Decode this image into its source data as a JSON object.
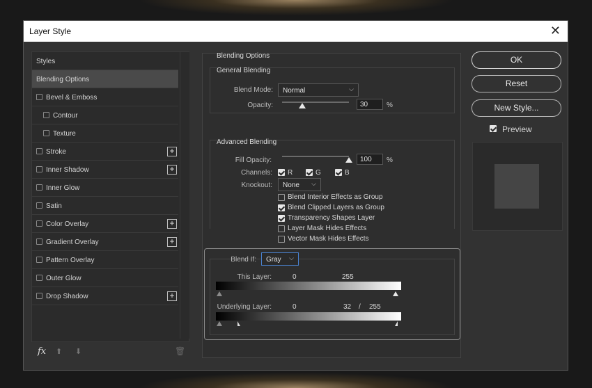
{
  "dialog": {
    "title": "Layer Style"
  },
  "styles_list": {
    "items": [
      {
        "label": "Styles",
        "checkbox": false,
        "plus": false,
        "indent": false,
        "selected": false
      },
      {
        "label": "Blending Options",
        "checkbox": false,
        "plus": false,
        "indent": false,
        "selected": true
      },
      {
        "label": "Bevel & Emboss",
        "checkbox": true,
        "plus": false,
        "indent": false,
        "selected": false
      },
      {
        "label": "Contour",
        "checkbox": true,
        "plus": false,
        "indent": true,
        "selected": false
      },
      {
        "label": "Texture",
        "checkbox": true,
        "plus": false,
        "indent": true,
        "selected": false
      },
      {
        "label": "Stroke",
        "checkbox": true,
        "plus": true,
        "indent": false,
        "selected": false
      },
      {
        "label": "Inner Shadow",
        "checkbox": true,
        "plus": true,
        "indent": false,
        "selected": false
      },
      {
        "label": "Inner Glow",
        "checkbox": true,
        "plus": false,
        "indent": false,
        "selected": false
      },
      {
        "label": "Satin",
        "checkbox": true,
        "plus": false,
        "indent": false,
        "selected": false
      },
      {
        "label": "Color Overlay",
        "checkbox": true,
        "plus": true,
        "indent": false,
        "selected": false
      },
      {
        "label": "Gradient Overlay",
        "checkbox": true,
        "plus": true,
        "indent": false,
        "selected": false
      },
      {
        "label": "Pattern Overlay",
        "checkbox": true,
        "plus": false,
        "indent": false,
        "selected": false
      },
      {
        "label": "Outer Glow",
        "checkbox": true,
        "plus": false,
        "indent": false,
        "selected": false
      },
      {
        "label": "Drop Shadow",
        "checkbox": true,
        "plus": true,
        "indent": false,
        "selected": false
      }
    ],
    "fx_label": "fx"
  },
  "blending": {
    "section_title": "Blending Options",
    "general": {
      "title": "General Blending",
      "blend_mode_label": "Blend Mode:",
      "blend_mode_value": "Normal",
      "opacity_label": "Opacity:",
      "opacity_value": "30",
      "opacity_level": 0.3,
      "unit": "%"
    },
    "advanced": {
      "title": "Advanced Blending",
      "fill_opacity_label": "Fill Opacity:",
      "fill_opacity_value": "100",
      "fill_opacity_level": 1.0,
      "unit": "%",
      "channels_label": "Channels:",
      "channels": [
        {
          "label": "R",
          "checked": true
        },
        {
          "label": "G",
          "checked": true
        },
        {
          "label": "B",
          "checked": true
        }
      ],
      "knockout_label": "Knockout:",
      "knockout_value": "None",
      "options": [
        {
          "label": "Blend Interior Effects as Group",
          "checked": false
        },
        {
          "label": "Blend Clipped Layers as Group",
          "checked": true
        },
        {
          "label": "Transparency Shapes Layer",
          "checked": true
        },
        {
          "label": "Layer Mask Hides Effects",
          "checked": false
        },
        {
          "label": "Vector Mask Hides Effects",
          "checked": false
        }
      ]
    },
    "blend_if": {
      "label": "Blend If:",
      "value": "Gray",
      "this_layer_label": "This Layer:",
      "this_layer_low": "0",
      "this_layer_high": "255",
      "underlying_label": "Underlying Layer:",
      "underlying_low": "0",
      "underlying_split_low": "32",
      "underlying_sep": "/",
      "underlying_high": "255"
    }
  },
  "buttons": {
    "ok": "OK",
    "reset": "Reset",
    "new_style": "New Style..."
  },
  "preview": {
    "label": "Preview",
    "checked": true
  }
}
